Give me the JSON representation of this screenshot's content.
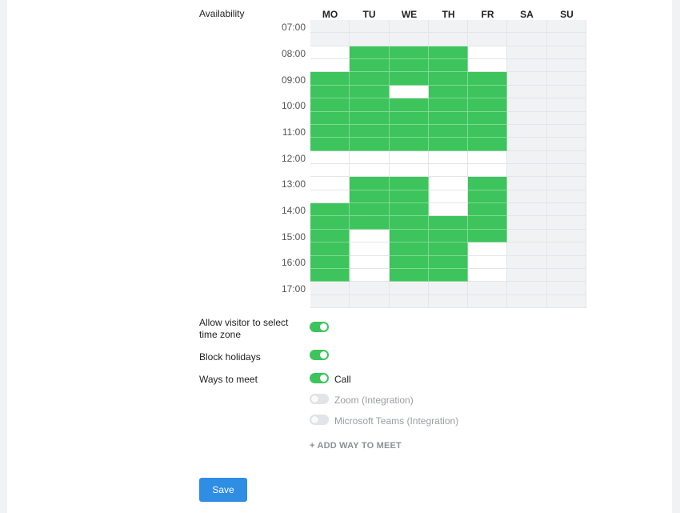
{
  "availability": {
    "label": "Availability",
    "days": [
      "MO",
      "TU",
      "WE",
      "TH",
      "FR",
      "SA",
      "SU"
    ],
    "times": [
      "07:00",
      "08:00",
      "09:00",
      "10:00",
      "11:00",
      "12:00",
      "13:00",
      "14:00",
      "15:00",
      "16:00",
      "17:00"
    ],
    "slot_rows_per_hour": 2,
    "colors": {
      "available": "#3dc45c",
      "unavailable": "#ffffff",
      "outside": "#f1f2f4"
    },
    "selected": {
      "MO": [
        0,
        0,
        0,
        0,
        1,
        1,
        1,
        1,
        1,
        1,
        0,
        0,
        0,
        0,
        1,
        1,
        1,
        1,
        1,
        1,
        0,
        0
      ],
      "TU": [
        0,
        0,
        1,
        1,
        1,
        1,
        1,
        1,
        1,
        1,
        0,
        0,
        1,
        1,
        1,
        1,
        0,
        0,
        0,
        0,
        0,
        0
      ],
      "WE": [
        0,
        0,
        1,
        1,
        1,
        0,
        1,
        1,
        1,
        1,
        0,
        0,
        1,
        1,
        1,
        1,
        1,
        1,
        1,
        1,
        0,
        0
      ],
      "TH": [
        0,
        0,
        1,
        1,
        1,
        1,
        1,
        1,
        1,
        1,
        0,
        0,
        0,
        0,
        0,
        1,
        1,
        1,
        1,
        1,
        0,
        0
      ],
      "FR": [
        0,
        0,
        0,
        0,
        1,
        1,
        1,
        1,
        1,
        1,
        0,
        0,
        1,
        1,
        1,
        1,
        1,
        0,
        0,
        0,
        0,
        0
      ],
      "SA": [
        0,
        0,
        0,
        0,
        0,
        0,
        0,
        0,
        0,
        0,
        0,
        0,
        0,
        0,
        0,
        0,
        0,
        0,
        0,
        0,
        0,
        0
      ],
      "SU": [
        0,
        0,
        0,
        0,
        0,
        0,
        0,
        0,
        0,
        0,
        0,
        0,
        0,
        0,
        0,
        0,
        0,
        0,
        0,
        0,
        0,
        0
      ]
    },
    "working": {
      "MO": [
        0,
        0,
        1,
        1,
        1,
        1,
        1,
        1,
        1,
        1,
        1,
        1,
        1,
        1,
        1,
        1,
        1,
        1,
        1,
        1,
        0,
        0
      ],
      "TU": [
        0,
        0,
        1,
        1,
        1,
        1,
        1,
        1,
        1,
        1,
        1,
        1,
        1,
        1,
        1,
        1,
        1,
        1,
        1,
        1,
        0,
        0
      ],
      "WE": [
        0,
        0,
        1,
        1,
        1,
        1,
        1,
        1,
        1,
        1,
        1,
        1,
        1,
        1,
        1,
        1,
        1,
        1,
        1,
        1,
        0,
        0
      ],
      "TH": [
        0,
        0,
        1,
        1,
        1,
        1,
        1,
        1,
        1,
        1,
        1,
        1,
        1,
        1,
        1,
        1,
        1,
        1,
        1,
        1,
        0,
        0
      ],
      "FR": [
        0,
        0,
        1,
        1,
        1,
        1,
        1,
        1,
        1,
        1,
        1,
        1,
        1,
        1,
        1,
        1,
        1,
        1,
        1,
        1,
        0,
        0
      ],
      "SA": [
        0,
        0,
        0,
        0,
        0,
        0,
        0,
        0,
        0,
        0,
        0,
        0,
        0,
        0,
        0,
        0,
        0,
        0,
        0,
        0,
        0,
        0
      ],
      "SU": [
        0,
        0,
        0,
        0,
        0,
        0,
        0,
        0,
        0,
        0,
        0,
        0,
        0,
        0,
        0,
        0,
        0,
        0,
        0,
        0,
        0,
        0
      ]
    }
  },
  "settings": {
    "timezone": {
      "label": "Allow visitor to select time zone",
      "enabled": true
    },
    "holidays": {
      "label": "Block holidays",
      "enabled": true
    },
    "ways_to_meet": {
      "label": "Ways to meet",
      "options": [
        {
          "label": "Call",
          "enabled": true
        },
        {
          "label": "Zoom (Integration)",
          "enabled": false
        },
        {
          "label": "Microsoft Teams (Integration)",
          "enabled": false
        }
      ],
      "add_label": "+ ADD WAY TO MEET"
    }
  },
  "save_label": "Save"
}
